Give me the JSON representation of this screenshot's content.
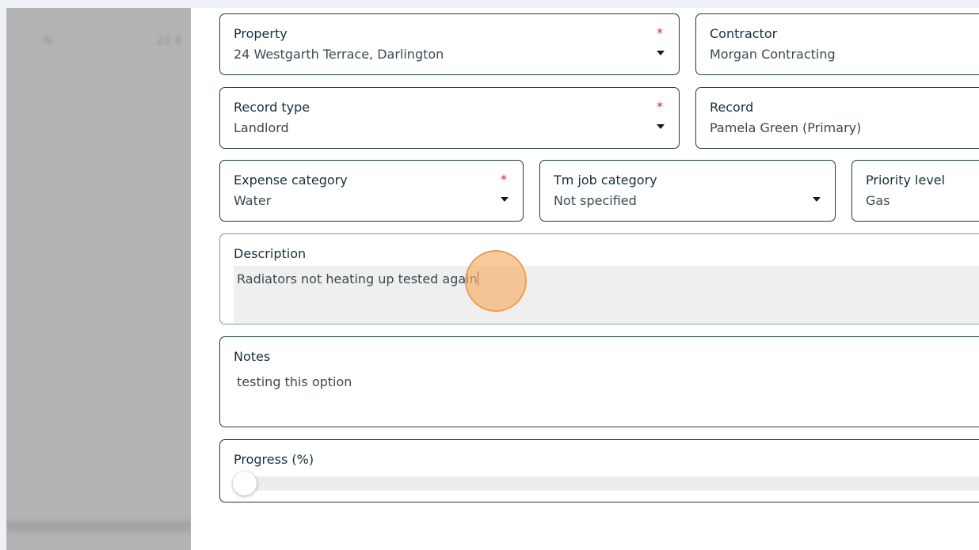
{
  "background_list": {
    "blurred_cells": [
      "",
      "%",
      "22 4"
    ]
  },
  "form": {
    "property": {
      "label": "Property",
      "value": "24 Westgarth Terrace, Darlington",
      "required": "*"
    },
    "contractor": {
      "label": "Contractor",
      "value": "Morgan Contracting"
    },
    "record_type": {
      "label": "Record type",
      "value": "Landlord",
      "required": "*"
    },
    "record": {
      "label": "Record",
      "value": "Pamela Green (Primary)"
    },
    "expense_category": {
      "label": "Expense category",
      "value": "Water",
      "required": "*"
    },
    "tm_job_category": {
      "label": "Tm job category",
      "value": "Not specified"
    },
    "priority_level": {
      "label": "Priority level",
      "value": "Gas"
    },
    "description": {
      "label": "Description",
      "value": "Radiators not heating up tested again"
    },
    "notes": {
      "label": "Notes",
      "value": "testing this option"
    },
    "progress": {
      "label": "Progress (%)",
      "value": 0
    }
  },
  "colors": {
    "required": "#d4233b",
    "border": "#1f3a44",
    "click_indicator": "#f6ab60"
  }
}
